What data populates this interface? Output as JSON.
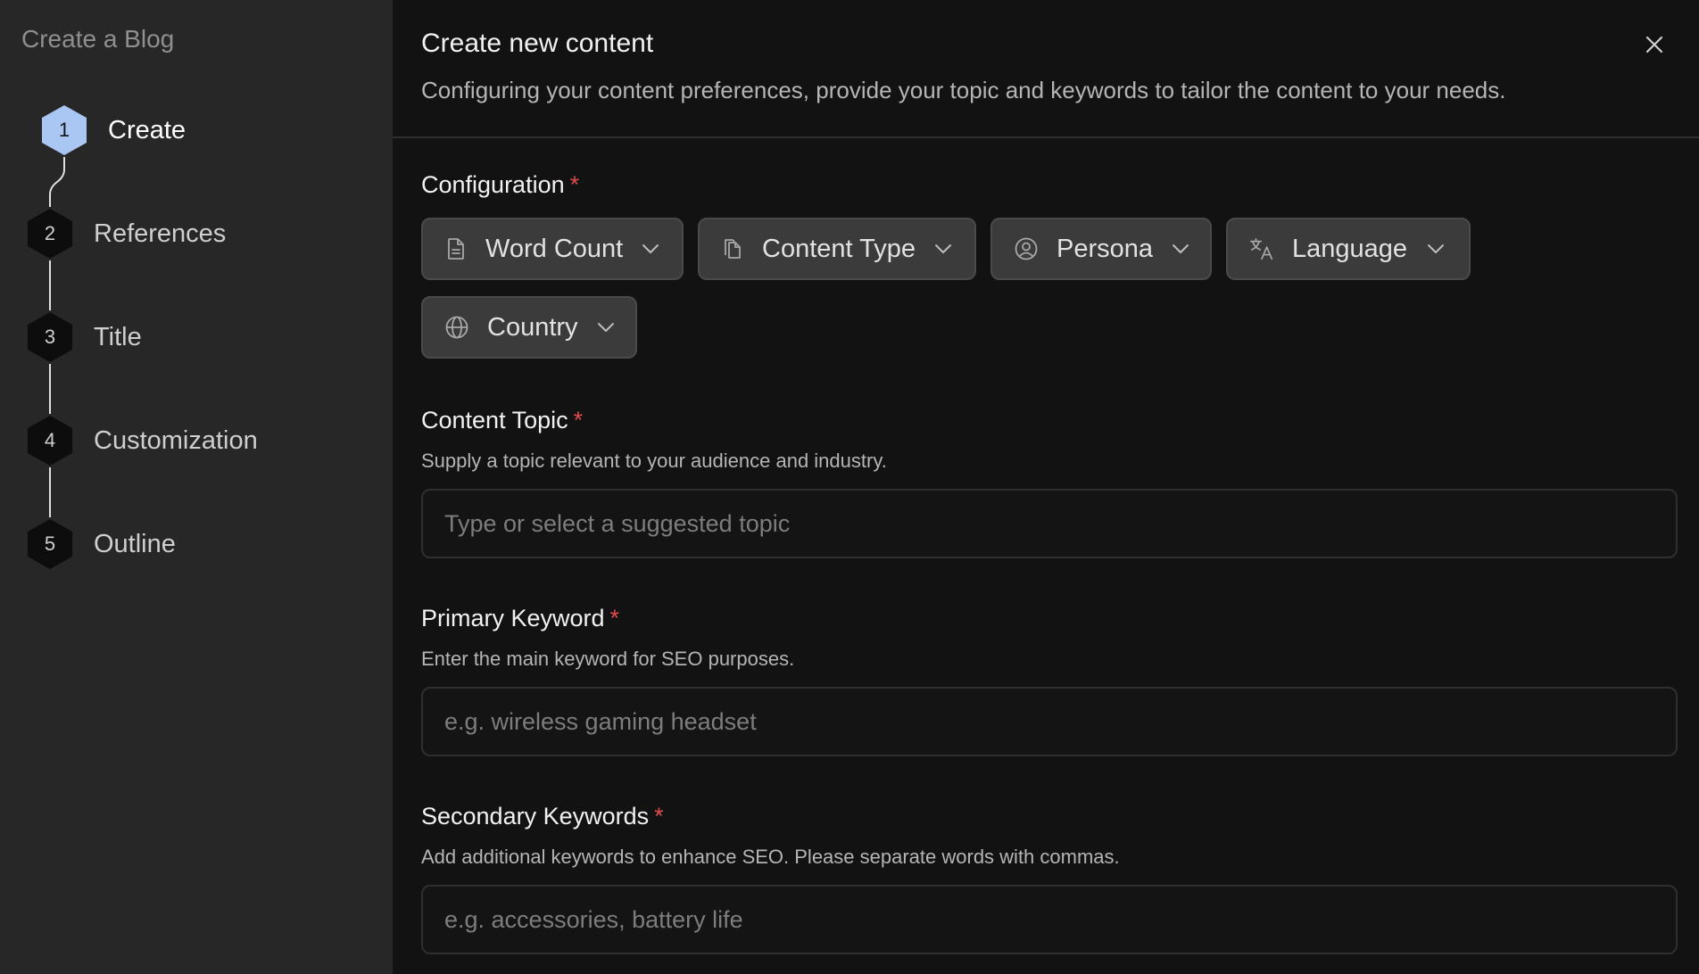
{
  "sidebar": {
    "title": "Create a Blog",
    "steps": [
      {
        "number": "1",
        "label": "Create",
        "active": true
      },
      {
        "number": "2",
        "label": "References",
        "active": false
      },
      {
        "number": "3",
        "label": "Title",
        "active": false
      },
      {
        "number": "4",
        "label": "Customization",
        "active": false
      },
      {
        "number": "5",
        "label": "Outline",
        "active": false
      }
    ]
  },
  "header": {
    "title": "Create new content",
    "subtitle": "Configuring your content preferences, provide your topic and keywords to tailor the content to your needs.",
    "close_icon": "close-icon"
  },
  "configuration": {
    "label": "Configuration",
    "required_mark": "*",
    "dropdowns": [
      {
        "label": "Word Count",
        "icon": "document-icon"
      },
      {
        "label": "Content Type",
        "icon": "copy-icon"
      },
      {
        "label": "Persona",
        "icon": "user-circle-icon"
      },
      {
        "label": "Language",
        "icon": "translate-icon"
      },
      {
        "label": "Country",
        "icon": "globe-icon"
      }
    ]
  },
  "content_topic": {
    "label": "Content Topic",
    "required_mark": "*",
    "help": "Supply a topic relevant to your audience and industry.",
    "placeholder": "Type or select a suggested topic",
    "value": ""
  },
  "primary_keyword": {
    "label": "Primary Keyword",
    "required_mark": "*",
    "help": "Enter the main keyword for SEO purposes.",
    "placeholder": "e.g. wireless gaming headset",
    "value": ""
  },
  "secondary_keywords": {
    "label": "Secondary Keywords",
    "required_mark": "*",
    "help": "Add additional keywords to enhance SEO. Please separate words with commas.",
    "placeholder": "e.g. accessories, battery life",
    "value": ""
  },
  "colors": {
    "sidebar_bg": "#272727",
    "main_bg": "#121212",
    "active_step": "#a9c7f2",
    "required": "#e04b4b"
  }
}
